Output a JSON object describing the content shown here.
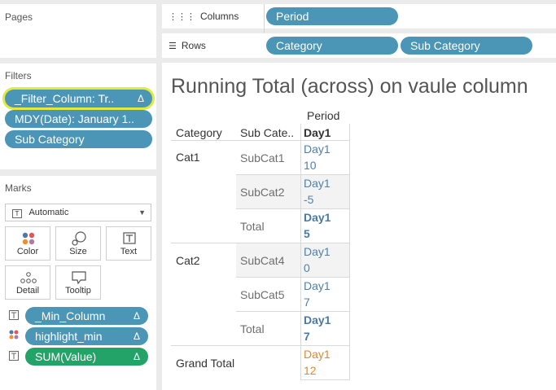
{
  "pages": {
    "label": "Pages"
  },
  "filters": {
    "label": "Filters",
    "items": [
      {
        "label": "_Filter_Column: Tr..",
        "delta": "Δ"
      },
      {
        "label": "MDY(Date): January 1.."
      },
      {
        "label": "Sub Category"
      }
    ]
  },
  "marks": {
    "label": "Marks",
    "type": "Automatic",
    "type_icon": "T",
    "buttons": [
      {
        "label": "Color"
      },
      {
        "label": "Size"
      },
      {
        "label": "Text"
      },
      {
        "label": "Detail"
      },
      {
        "label": "Tooltip"
      }
    ],
    "fields": [
      {
        "label": "_Min_Column",
        "delta": "Δ"
      },
      {
        "label": "highlight_min",
        "delta": "Δ"
      },
      {
        "label": "SUM(Value)",
        "delta": "Δ"
      }
    ]
  },
  "columns_shelf": {
    "label": "Columns",
    "pills": [
      "Period"
    ]
  },
  "rows_shelf": {
    "label": "Rows",
    "pills": [
      "Category",
      "Sub Category"
    ]
  },
  "view": {
    "title": "Running Total (across) on vaule column",
    "col_header_group": "Period",
    "headers": {
      "category": "Category",
      "sub_category": "Sub Cate..",
      "period": "Day1"
    },
    "rows": [
      {
        "category": "Cat1",
        "sub": "SubCat1",
        "day": "Day1",
        "value": "10"
      },
      {
        "category": "",
        "sub": "SubCat2",
        "day": "Day1",
        "value": "-5"
      },
      {
        "category": "",
        "sub": "Total",
        "day": "Day1",
        "value": "5"
      },
      {
        "category": "Cat2",
        "sub": "SubCat4",
        "day": "Day1",
        "value": "0"
      },
      {
        "category": "",
        "sub": "SubCat5",
        "day": "Day1",
        "value": "7"
      },
      {
        "category": "",
        "sub": "Total",
        "day": "Day1",
        "value": "7"
      }
    ],
    "grand_total": {
      "label": "Grand Total",
      "day": "Day1",
      "value": "12"
    }
  },
  "colors": {
    "pill_blue": "#4b95b7",
    "pill_green": "#23a368",
    "highlight_yellow": "#e3ea3e",
    "value_blue": "#4f81aa",
    "grand_total_orange": "#e08a2c"
  }
}
